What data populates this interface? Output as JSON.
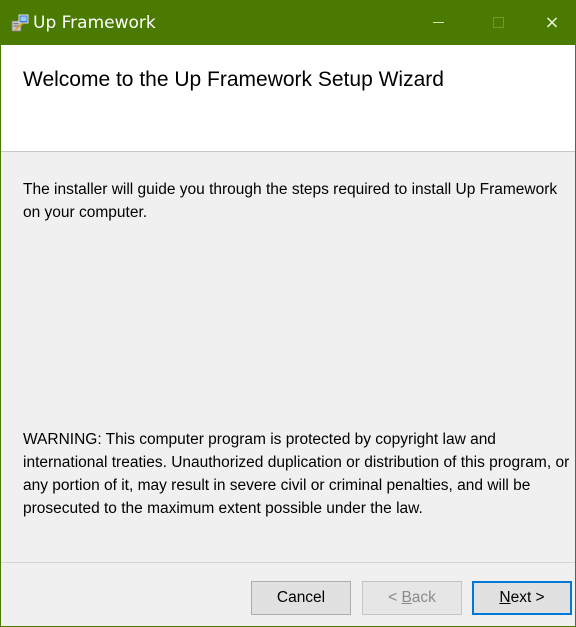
{
  "window": {
    "title": "Up Framework",
    "icon": "installer-package-icon",
    "controls": {
      "minimize": "minimize-icon",
      "maximize": "maximize-icon",
      "close": "×"
    }
  },
  "banner": {
    "title": "Welcome to the Up Framework Setup Wizard"
  },
  "content": {
    "intro": "The installer will guide you through the steps required to install Up Framework on your computer.",
    "warning": "WARNING: This computer program is protected by copyright law and international treaties. Unauthorized duplication or distribution of this program, or any portion of it, may result in severe civil or criminal penalties, and will be prosecuted to the maximum extent possible under the law."
  },
  "buttons": {
    "cancel": "Cancel",
    "back_prefix": "< ",
    "back_mnemonic": "B",
    "back_rest": "ack",
    "next_mnemonic": "N",
    "next_rest": "ext >",
    "back_enabled": false
  },
  "colors": {
    "titlebar": "#4a7b00",
    "content_bg": "#f0f0f0",
    "focus_border": "#0078d7"
  }
}
